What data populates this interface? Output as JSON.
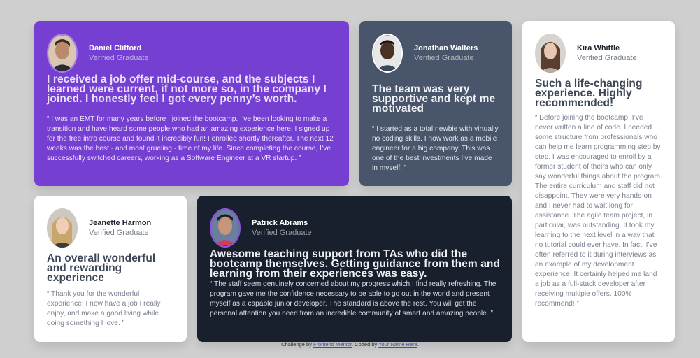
{
  "testimonials": [
    {
      "name": "Daniel Clifford",
      "role": "Verified Graduate",
      "headline": "I received a job offer mid-course, and the subjects I learned were current, if not more so, in the company I joined. I honestly feel I got every penny’s worth.",
      "quote": "“ I was an EMT for many years before I joined the bootcamp. I’ve been looking to make a transition and have heard some people who had an amazing experience here. I signed up for the free intro course and found it incredibly fun! I enrolled shortly thereafter. The next 12 weeks was the best - and most grueling - time of my life. Since completing the course, I’ve successfully switched careers, working as a Software Engineer at a VR startup. ”",
      "bg": "#7540d2"
    },
    {
      "name": "Jonathan Walters",
      "role": "Verified Graduate",
      "headline": "The team was very supportive and kept me motivated",
      "quote": "“ I started as a total newbie with virtually no coding skills. I now work as a mobile engineer for a big company. This was one of the best investments I’ve made in myself. ”",
      "bg": "#48556a"
    },
    {
      "name": "Kira Whittle",
      "role": "Verified Graduate",
      "headline": "Such a life-changing experience. Highly recommended!",
      "quote": "“ Before joining the bootcamp, I’ve never written a line of code. I needed some structure from professionals who can help me learn programming step by step. I was encouraged to enroll by a former student of theirs who can only say wonderful things about the program. The entire curriculum and staff did not disappoint. They were very hands-on and I never had to wait long for assistance. The agile team project, in particular, was outstanding. It took my learning to the next level in a way that no tutorial could ever have. In fact, I’ve often referred to it during interviews as an example of my development experience. It certainly helped me land a job as a full-stack developer after receiving multiple offers. 100% recommend! ”",
      "bg": "#ffffff"
    },
    {
      "name": "Jeanette Harmon",
      "role": "Verified Graduate",
      "headline": "An overall wonderful and rewarding experience",
      "quote": "“ Thank you for the wonderful experience! I now have a job I really enjoy, and make a good living while doing something I love. ”",
      "bg": "#ffffff"
    },
    {
      "name": "Patrick Abrams",
      "role": "Verified Graduate",
      "headline": "Awesome teaching support from TAs who did the bootcamp themselves. Getting guidance from them and learning from their experiences was easy.",
      "quote": "“ The staff seem genuinely concerned about my progress which I find really refreshing. The program gave me the confidence necessary to be able to go out in the world and present myself as a capable junior developer. The standard is above the rest. You will get the personal attention you need from an incredible community of smart and amazing people. ”",
      "bg": "#19202d"
    }
  ],
  "attribution": {
    "prefix": "Challenge by",
    "link1": "Frontend Mentor",
    "middle": ". Coded by",
    "link2": "Your Name Here",
    "suffix": "."
  }
}
